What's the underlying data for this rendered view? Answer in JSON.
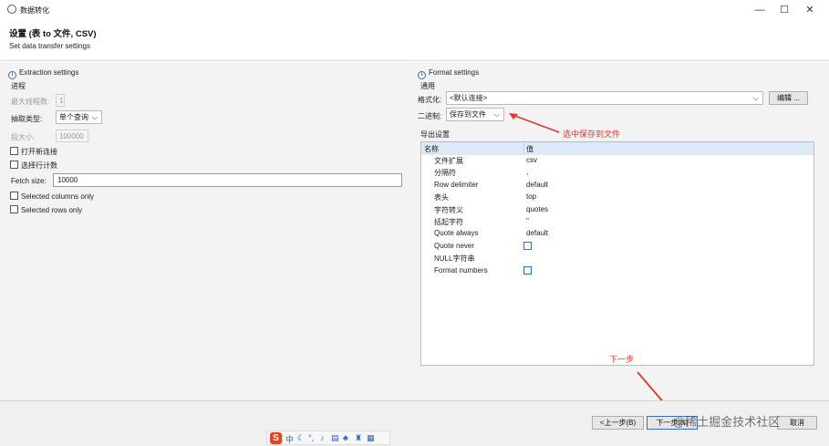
{
  "window": {
    "title": "数据转化",
    "minimize_glyph": "—",
    "maximize_glyph": "☐",
    "close_glyph": "✕"
  },
  "header": {
    "title": "设置 (表 to 文件, CSV)",
    "description": "Set data transfer settings"
  },
  "extraction": {
    "section_title": "Extraction settings",
    "group": "进程",
    "max_threads_label": "最大线程数:",
    "max_threads_value": "1",
    "extract_type_label": "抽取类型:",
    "extract_type_value": "单个查询",
    "segment_size_label": "段大小:",
    "segment_size_value": "100000",
    "open_new_connection": "打开新连接",
    "select_row_count": "选择行计数",
    "fetch_size_label": "Fetch size:",
    "fetch_size_value": "10000",
    "selected_columns_only": "Selected columns only",
    "selected_rows_only": "Selected rows only"
  },
  "format": {
    "section_title": "Format settings",
    "group": "通用",
    "formatter_label": "格式化:",
    "formatter_value": "<默认连接>",
    "edit_button": "编辑 ...",
    "binary_label": "二进制:",
    "binary_value": "保存到文件",
    "export_settings_label": "导出设置",
    "table_header": {
      "name": "名称",
      "value": "值"
    },
    "properties": [
      {
        "name": "文件扩展",
        "value": "csv",
        "type": "text"
      },
      {
        "name": "分隔符",
        "value": ",",
        "type": "text"
      },
      {
        "name": "Row delimiter",
        "value": "default",
        "type": "text"
      },
      {
        "name": "表头",
        "value": "top",
        "type": "text"
      },
      {
        "name": "字符转义",
        "value": "quotes",
        "type": "text"
      },
      {
        "name": "括起字符",
        "value": "\"",
        "type": "text"
      },
      {
        "name": "Quote always",
        "value": "default",
        "type": "text"
      },
      {
        "name": "Quote never",
        "value": "",
        "type": "checkbox"
      },
      {
        "name": "NULL字符串",
        "value": "",
        "type": "text"
      },
      {
        "name": "Format numbers",
        "value": "",
        "type": "checkbox"
      }
    ]
  },
  "annotations": {
    "binary_note": "选中保存到文件",
    "next_note": "下一步"
  },
  "buttons": {
    "back": "<上一步(B)",
    "next": "下一步(N)",
    "cancel": "取消"
  },
  "watermark": "@稀土掘金技术社区",
  "colors": {
    "accent": "#3a6fb5",
    "annotation": "#e03a2e",
    "selection": "#dce9f7"
  }
}
